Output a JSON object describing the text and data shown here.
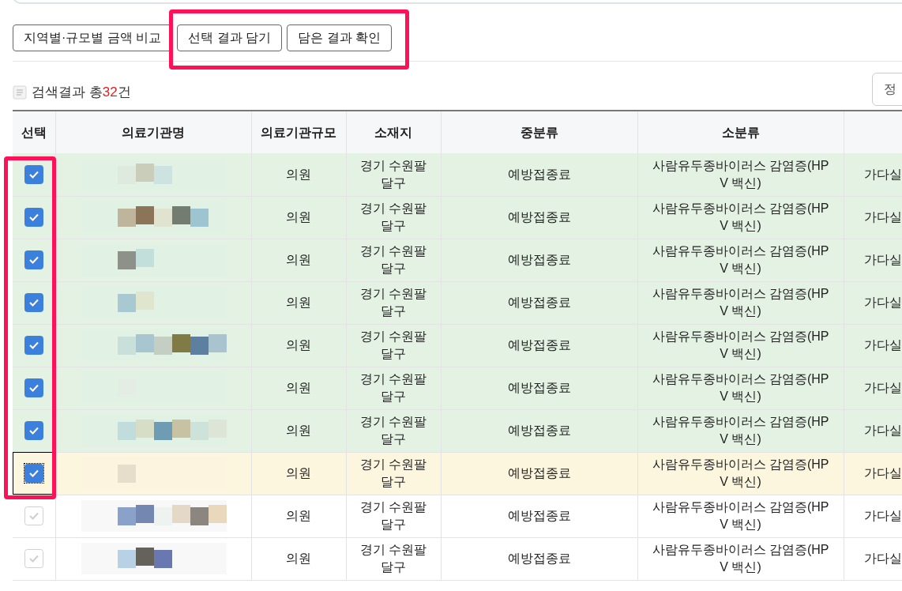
{
  "toolbar": {
    "buttons": [
      "지역별·규모별 금액 비교",
      "선택 결과 담기",
      "담은 결과 확인"
    ]
  },
  "result_summary": {
    "count": "32",
    "prefix": "검색결과 총",
    "suffix": "건"
  },
  "sort_button": {
    "label": "정"
  },
  "table": {
    "columns": [
      "선택",
      "의료기관명",
      "의료기관규모",
      "소재지",
      "중분류",
      "소분류",
      ""
    ],
    "rows": [
      {
        "checked": true,
        "focused": false,
        "size": "의원",
        "location": "경기 수원팔달구",
        "category": "예방접종료",
        "subcategory": "사람유두종바이러스 감염증(HPV 백신)",
        "column_7": "가다실"
      },
      {
        "checked": true,
        "focused": false,
        "size": "의원",
        "location": "경기 수원팔달구",
        "category": "예방접종료",
        "subcategory": "사람유두종바이러스 감염증(HPV 백신)",
        "column_7": "가다실"
      },
      {
        "checked": true,
        "focused": false,
        "size": "의원",
        "location": "경기 수원팔달구",
        "category": "예방접종료",
        "subcategory": "사람유두종바이러스 감염증(HPV 백신)",
        "column_7": "가다실"
      },
      {
        "checked": true,
        "focused": false,
        "size": "의원",
        "location": "경기 수원팔달구",
        "category": "예방접종료",
        "subcategory": "사람유두종바이러스 감염증(HPV 백신)",
        "column_7": "가다실"
      },
      {
        "checked": true,
        "focused": false,
        "size": "의원",
        "location": "경기 수원팔달구",
        "category": "예방접종료",
        "subcategory": "사람유두종바이러스 감염증(HPV 백신)",
        "column_7": "가다실"
      },
      {
        "checked": true,
        "focused": false,
        "size": "의원",
        "location": "경기 수원팔달구",
        "category": "예방접종료",
        "subcategory": "사람유두종바이러스 감염증(HPV 백신)",
        "column_7": "가다실"
      },
      {
        "checked": true,
        "focused": false,
        "size": "의원",
        "location": "경기 수원팔달구",
        "category": "예방접종료",
        "subcategory": "사람유두종바이러스 감염증(HPV 백신)",
        "column_7": "가다실"
      },
      {
        "checked": true,
        "focused": true,
        "size": "의원",
        "location": "경기 수원팔달구",
        "category": "예방접종료",
        "subcategory": "사람유두종바이러스 감염증(HPV 백신)",
        "column_7": "가다실"
      },
      {
        "checked": false,
        "focused": false,
        "size": "의원",
        "location": "경기 수원팔달구",
        "category": "예방접종료",
        "subcategory": "사람유두종바이러스 감염증(HPV 백신)",
        "column_7": "가다실"
      },
      {
        "checked": false,
        "focused": false,
        "size": "의원",
        "location": "경기 수원팔달구",
        "category": "예방접종료",
        "subcategory": "사람유두종바이러스 감염증(HPV 백신)",
        "column_7": "가다실"
      }
    ]
  }
}
